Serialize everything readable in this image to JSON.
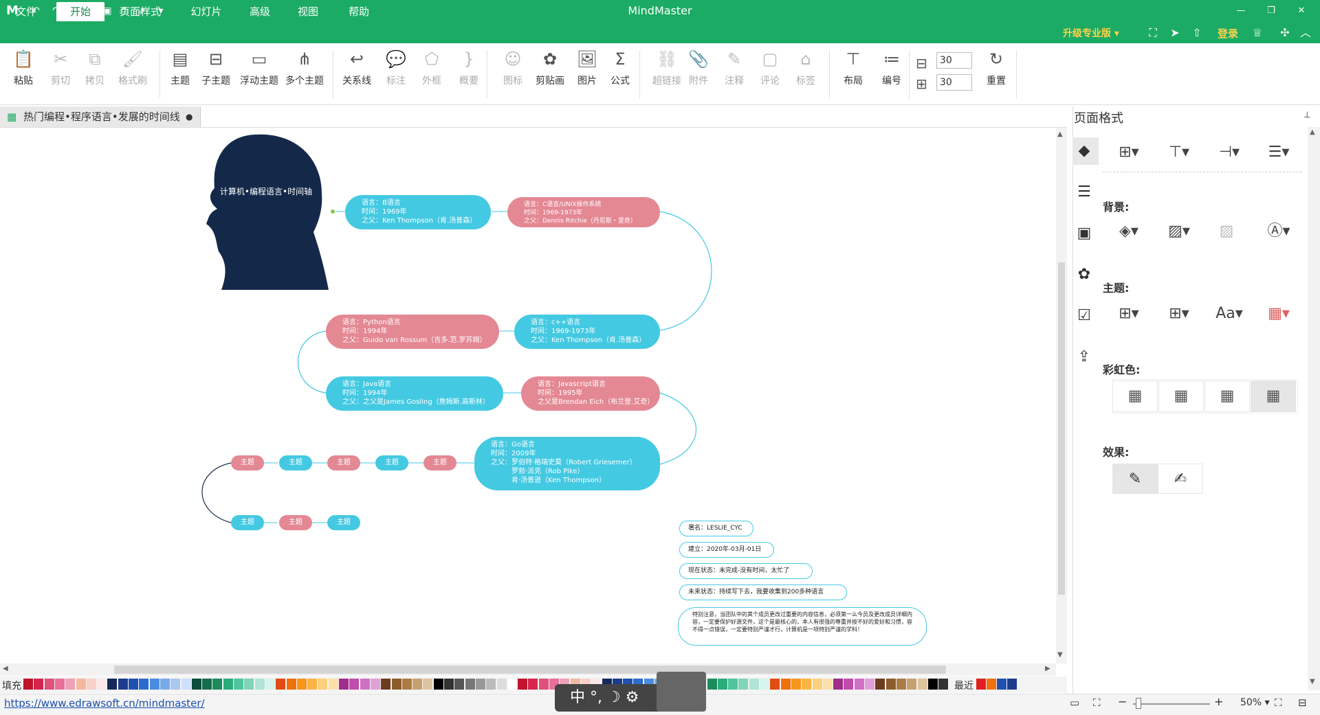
{
  "app": {
    "title": "MindMaster",
    "logo": "mindmaster-logo-icon"
  },
  "quick_access": [
    "undo-icon",
    "redo-icon",
    "new-icon",
    "open-icon",
    "save-icon",
    "print-icon",
    "export-icon",
    "customize-icon"
  ],
  "menu": {
    "tabs": [
      "文件",
      "开始",
      "页面样式",
      "幻灯片",
      "高级",
      "视图",
      "帮助"
    ],
    "active": "开始",
    "upgrade": "升级专业版",
    "login": "登录"
  },
  "ribbon": {
    "buttons": [
      {
        "label": "粘贴",
        "icon": "paste-icon",
        "enabled": true
      },
      {
        "label": "剪切",
        "icon": "cut-icon",
        "enabled": false
      },
      {
        "label": "拷贝",
        "icon": "copy-icon",
        "enabled": false
      },
      {
        "label": "格式刷",
        "icon": "format-brush-icon",
        "enabled": false
      },
      {
        "label": "主题",
        "icon": "topic-icon",
        "enabled": true
      },
      {
        "label": "子主题",
        "icon": "subtopic-icon",
        "enabled": true
      },
      {
        "label": "浮动主题",
        "icon": "floating-topic-icon",
        "enabled": true
      },
      {
        "label": "多个主题",
        "icon": "multi-topic-icon",
        "enabled": true
      },
      {
        "label": "关系线",
        "icon": "relationship-icon",
        "enabled": true
      },
      {
        "label": "标注",
        "icon": "callout-icon",
        "enabled": false
      },
      {
        "label": "外框",
        "icon": "boundary-icon",
        "enabled": false
      },
      {
        "label": "概要",
        "icon": "summary-icon",
        "enabled": false
      },
      {
        "label": "图标",
        "icon": "icon-icon",
        "enabled": false
      },
      {
        "label": "剪贴画",
        "icon": "clipart-icon",
        "enabled": true
      },
      {
        "label": "图片",
        "icon": "picture-icon",
        "enabled": true
      },
      {
        "label": "公式",
        "icon": "formula-icon",
        "enabled": true
      },
      {
        "label": "超链接",
        "icon": "hyperlink-icon",
        "enabled": false
      },
      {
        "label": "附件",
        "icon": "attachment-icon",
        "enabled": false
      },
      {
        "label": "注释",
        "icon": "note-icon",
        "enabled": false
      },
      {
        "label": "评论",
        "icon": "comment-icon",
        "enabled": false
      },
      {
        "label": "标签",
        "icon": "tag-icon",
        "enabled": false
      },
      {
        "label": "布局",
        "icon": "layout-icon",
        "enabled": true
      },
      {
        "label": "编号",
        "icon": "numbering-icon",
        "enabled": true
      },
      {
        "label": "重置",
        "icon": "reset-icon",
        "enabled": true
      }
    ],
    "spin_h": "30",
    "spin_v": "30"
  },
  "document": {
    "tab_title": "热门编程•程序语言•发展的时间线"
  },
  "panel": {
    "title": "页面格式",
    "background_label": "背景:",
    "theme_label": "主题:",
    "rainbow_label": "彩虹色:",
    "effect_label": "效果:"
  },
  "mindmap": {
    "root": "计算机•编程语言•时间轴",
    "nodes": [
      {
        "lines": [
          "语言：B语言",
          "时间：1969年",
          "之父：Ken Thompson（肯.汤普森）"
        ]
      },
      {
        "lines": [
          "语言：C语言/UNIX操作系统",
          "时间：1969-1973年",
          "之父：Dennis Ritchie（丹尼斯・里奇）"
        ]
      },
      {
        "lines": [
          "语言：c++语言",
          "时间：1969-1973年",
          "之父：Ken Thompson（肯.汤普森）"
        ]
      },
      {
        "lines": [
          "语言：Python语言",
          "时间：1994年",
          "之父：Guido van Rossum（吉多.范.罗苏姆）"
        ]
      },
      {
        "lines": [
          "语言：Java语言",
          "时间：1994年",
          "之父：之父是James Gosling（詹姆斯.高斯林）"
        ]
      },
      {
        "lines": [
          "语言：Javascript语言",
          "时间：1995年",
          "之父是Brendan Eich（布兰登.艾奇）"
        ]
      },
      {
        "lines": [
          "语言：Go语言",
          "时间：2009年",
          "之父：罗伯特·格瑞史莫（Robert Griesemer）",
          "罗勃·派克（Rob Pike）",
          "肯·汤普逊（Ken Thompson）"
        ]
      }
    ],
    "topic_label": "主题",
    "notes": [
      "署名：LESLIE_CYC",
      "建立：2020年-03月-01日",
      "现在状态：未完成-没有时间，太忙了",
      "未来状态：持续写下去，我要收集到200多种语言",
      "特别注意，当团队中的其个成员更改过重要的内容信息，必须第一么今员及更改成员详细内容，一定要保护好源文件，这个是最核心的，本人有很强的尊重并按不好的爱好和习惯，容不得一点错误，一定要特别严谨才行，计算机是一项特别严谨的学科！"
    ]
  },
  "palette": {
    "fill_label": "填充",
    "recent_label": "最近"
  },
  "status": {
    "url": "https://www.edrawsoft.cn/mindmaster/",
    "zoom": "50%"
  },
  "ime": {
    "text": "中 °, ☽ ⚙"
  }
}
